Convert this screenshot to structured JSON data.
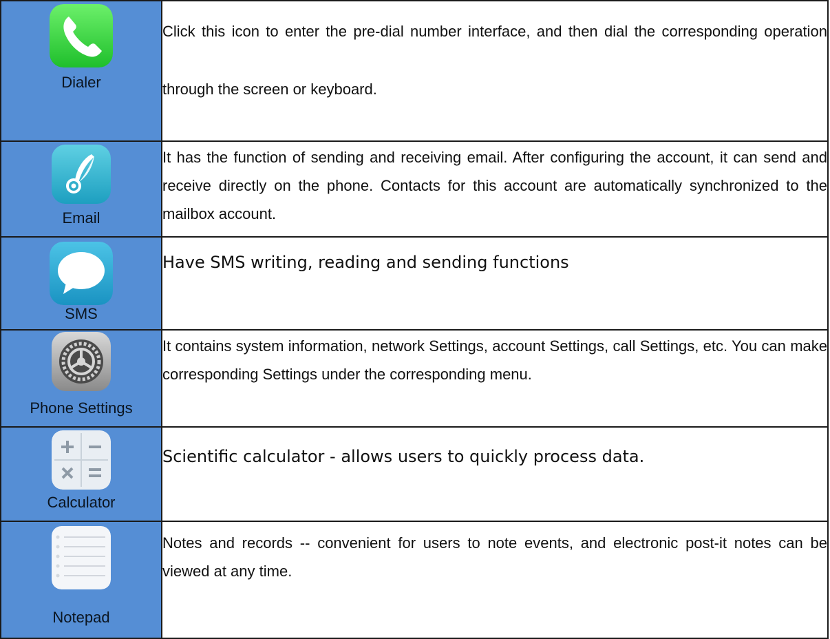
{
  "rows": [
    {
      "icon": "phone-icon",
      "label": "Dialer",
      "description": "Click this icon to enter the pre-dial number interface, and then dial the corresponding operation through the screen or keyboard."
    },
    {
      "icon": "email-quill-icon",
      "label": "Email",
      "description": "It has the function of sending and receiving email. After configuring the account, it can send and receive directly on the phone. Contacts for this account are automatically synchronized to the mailbox account."
    },
    {
      "icon": "speech-bubble-icon",
      "label": "SMS",
      "description": "Have SMS writing, reading and sending functions"
    },
    {
      "icon": "gear-icon",
      "label": "Phone Settings",
      "description": "It contains system information, network Settings, account Settings, call Settings, etc. You can make corresponding Settings under the corresponding menu."
    },
    {
      "icon": "calculator-icon",
      "label": "Calculator",
      "description": "Scientific calculator - allows users to quickly process data."
    },
    {
      "icon": "notepad-icon",
      "label": "Notepad",
      "description": "Notes and records -- convenient for users to note events, and electronic post-it notes can be viewed at any time."
    }
  ]
}
